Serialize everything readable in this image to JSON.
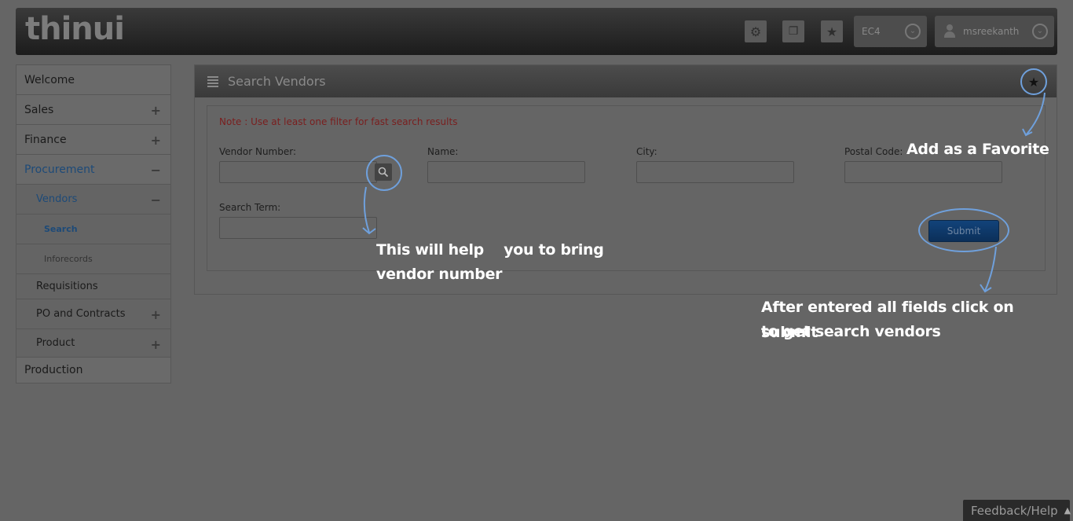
{
  "header": {
    "logo": "thinui",
    "system": "EC4",
    "user": "msreekanth"
  },
  "sidebar": {
    "items": [
      {
        "label": "Welcome"
      },
      {
        "label": "Sales",
        "sign": "+"
      },
      {
        "label": "Finance",
        "sign": "+"
      },
      {
        "label": "Procurement",
        "sign": "−"
      },
      {
        "label": "Vendors",
        "sign": "−"
      },
      {
        "label": "Search"
      },
      {
        "label": "Inforecords"
      },
      {
        "label": "Requisitions"
      },
      {
        "label": "PO and Contracts",
        "sign": "+"
      },
      {
        "label": "Product",
        "sign": "+"
      },
      {
        "label": "Production"
      }
    ]
  },
  "panel": {
    "title": "Search Vendors",
    "note": "Note : Use at least one filter for fast search results",
    "fields": {
      "vendor_number": "Vendor Number:",
      "name": "Name:",
      "city": "City:",
      "postal_code": "Postal Code:",
      "search_term": "Search Term:"
    },
    "submit_label": "Submit"
  },
  "annotations": {
    "favorite": "Add as a Favorite",
    "vendor_help_line1": "This will help    you to bring",
    "vendor_help_line2": "vendor number",
    "submit_help_line1": "After entered all fields click on submit",
    "submit_help_line2": "to get search vendors"
  },
  "footer": {
    "feedback": "Feedback/Help"
  },
  "colors": {
    "annotation_ring": "#6fa0dc",
    "active_nav": "#1d4a78",
    "note": "#7a1e1e"
  }
}
